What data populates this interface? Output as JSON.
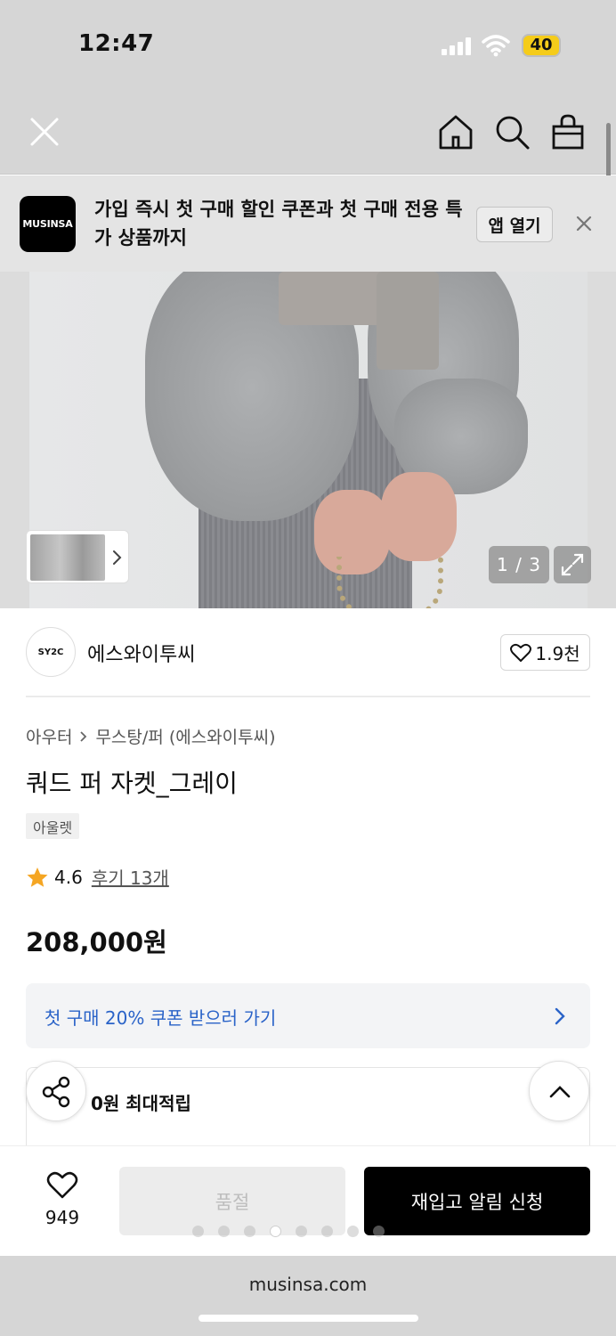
{
  "status": {
    "time": "12:47",
    "battery": "40"
  },
  "nav": {
    "close_icon": "close-icon",
    "home_icon": "home-icon",
    "search_icon": "search-icon",
    "cart_icon": "shopping-bag-icon"
  },
  "app_banner": {
    "logo_text": "MUSINSA",
    "text": "가입 즉시 첫 구매 할인 쿠폰과 첫 구매 전용 특가 상품까지",
    "open_label": "앱 열기"
  },
  "gallery": {
    "counter": "1 / 3"
  },
  "brand": {
    "logo_text": "SY2C",
    "name": "에스와이투씨",
    "likes": "1.9천"
  },
  "product": {
    "category": "아우터",
    "subcategory": "무스탕/퍼 (에스와이투씨)",
    "title": "쿼드 퍼 자켓_그레이",
    "tag": "아울렛",
    "rating": "4.6",
    "review_link": "후기 13개",
    "price": "208,000원"
  },
  "coupon": {
    "text": "첫 구매 20% 쿠폰 받으러 가기"
  },
  "points": {
    "text": "0원 최대적립"
  },
  "action_bar": {
    "wish_count": "949",
    "soldout_label": "품절",
    "restock_label": "재입고 알림 신청"
  },
  "url_bar": {
    "url": "musinsa.com"
  },
  "colors": {
    "accent_blue": "#2a63c8",
    "star": "#f5a623",
    "primary_button": "#000000"
  }
}
